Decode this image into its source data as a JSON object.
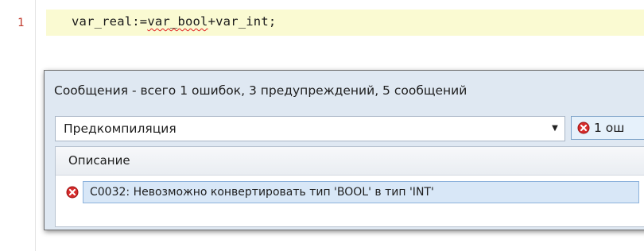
{
  "editor": {
    "line_number": "1",
    "code_before": "var_real:=",
    "code_error": "var_bool",
    "code_after": "+var_int;",
    "error_underline_color": "#e02020"
  },
  "messages": {
    "title": "Сообщения - всего 1 ошибок, 3 предупреждений, 5 сообщений",
    "filter_value": "Предкомпиляция",
    "error_filter_label": "1 ош",
    "table": {
      "columns": [
        "Описание"
      ],
      "rows": [
        {
          "severity": "error",
          "description": "C0032:  Невозможно конвертировать тип 'BOOL' в тип 'INT'"
        }
      ]
    }
  },
  "icons": {
    "error": "error-icon",
    "dropdown": "dropdown-arrow-icon"
  },
  "colors": {
    "error_red": "#d62b2b",
    "selection_blue": "#d8e7f7"
  }
}
